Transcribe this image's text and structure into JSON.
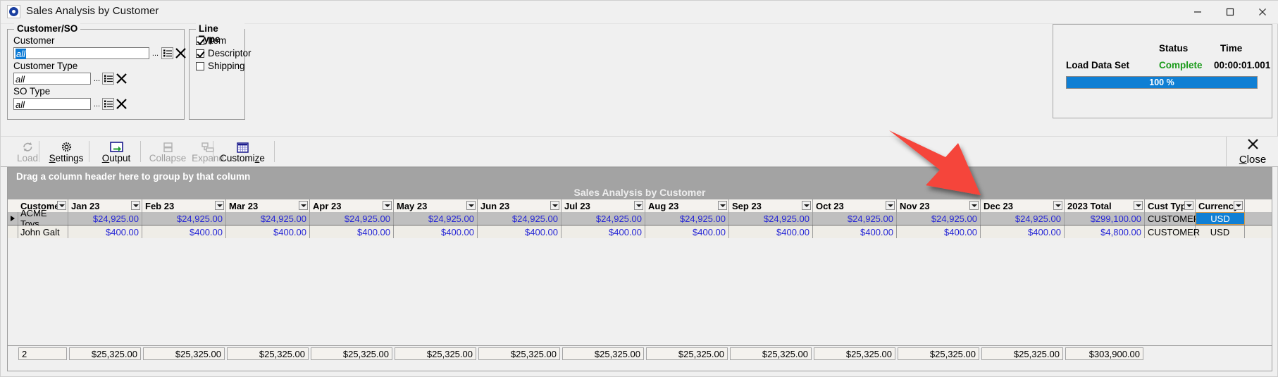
{
  "window": {
    "title": "Sales Analysis by Customer",
    "icon": "app-icon",
    "controls": {
      "minimize": "minimize-icon",
      "maximize": "maximize-icon",
      "close": "close-icon"
    }
  },
  "filters": {
    "customer_so": {
      "legend": "Customer/SO",
      "fields": [
        {
          "label": "Customer",
          "value": "all",
          "selected": true
        },
        {
          "label": "Customer Type",
          "value": "all",
          "selected": false
        },
        {
          "label": "SO Type",
          "value": "all",
          "selected": false
        }
      ],
      "buttons": {
        "ellipsis": "...",
        "list": "list-icon",
        "clear": "clear-icon"
      }
    },
    "line_type": {
      "legend": "Line Type",
      "options": [
        {
          "label": "Item",
          "checked": true
        },
        {
          "label": "Descriptor",
          "checked": true
        },
        {
          "label": "Shipping",
          "checked": false
        }
      ]
    }
  },
  "status_panel": {
    "col_status": "Status",
    "col_time": "Time",
    "task": "Load Data Set",
    "status": "Complete",
    "status_color": "#1a9a1a",
    "time": "00:00:01.001",
    "progress_label": "100 %",
    "progress_percent": 100,
    "progress_color": "#0f7fd4"
  },
  "toolbar": {
    "buttons": [
      {
        "name": "load",
        "label": "Load",
        "icon": "refresh-icon",
        "enabled": false
      },
      {
        "name": "settings",
        "label": "Settings",
        "icon": "gear-icon",
        "enabled": true
      },
      {
        "name": "output",
        "label": "Output",
        "icon": "export-icon",
        "enabled": true
      },
      {
        "name": "collapse",
        "label": "Collapse",
        "icon": "collapse-icon",
        "enabled": false
      },
      {
        "name": "expand",
        "label": "Expand",
        "icon": "expand-icon",
        "enabled": false
      },
      {
        "name": "customize",
        "label": "Customize",
        "icon": "grid-icon",
        "enabled": true
      }
    ],
    "close": {
      "label": "Close",
      "icon": "x-icon"
    }
  },
  "grid": {
    "group_hint": "Drag a column header here to group by that column",
    "caption": "Sales Analysis by Customer",
    "columns": [
      "Customer",
      "Jan 23",
      "Feb 23",
      "Mar 23",
      "Apr 23",
      "May 23",
      "Jun 23",
      "Jul 23",
      "Aug 23",
      "Sep 23",
      "Oct 23",
      "Nov 23",
      "Dec 23",
      "2023 Total",
      "Cust Type",
      "Currency"
    ],
    "rows": [
      {
        "selected_indicator": true,
        "cells": [
          "ACME Toys",
          "$24,925.00",
          "$24,925.00",
          "$24,925.00",
          "$24,925.00",
          "$24,925.00",
          "$24,925.00",
          "$24,925.00",
          "$24,925.00",
          "$24,925.00",
          "$24,925.00",
          "$24,925.00",
          "$24,925.00",
          "$299,100.00",
          "CUSTOMER",
          "USD"
        ],
        "highlight_cell": 15
      },
      {
        "selected_indicator": false,
        "cells": [
          "John Galt",
          "$400.00",
          "$400.00",
          "$400.00",
          "$400.00",
          "$400.00",
          "$400.00",
          "$400.00",
          "$400.00",
          "$400.00",
          "$400.00",
          "$400.00",
          "$400.00",
          "$4,800.00",
          "CUSTOMER",
          "USD"
        ],
        "highlight_cell": -1
      }
    ],
    "footer": [
      "2",
      "$25,325.00",
      "$25,325.00",
      "$25,325.00",
      "$25,325.00",
      "$25,325.00",
      "$25,325.00",
      "$25,325.00",
      "$25,325.00",
      "$25,325.00",
      "$25,325.00",
      "$25,325.00",
      "$25,325.00",
      "$303,900.00",
      "",
      ""
    ]
  },
  "annotation": {
    "arrow_color": "#f5443a"
  }
}
